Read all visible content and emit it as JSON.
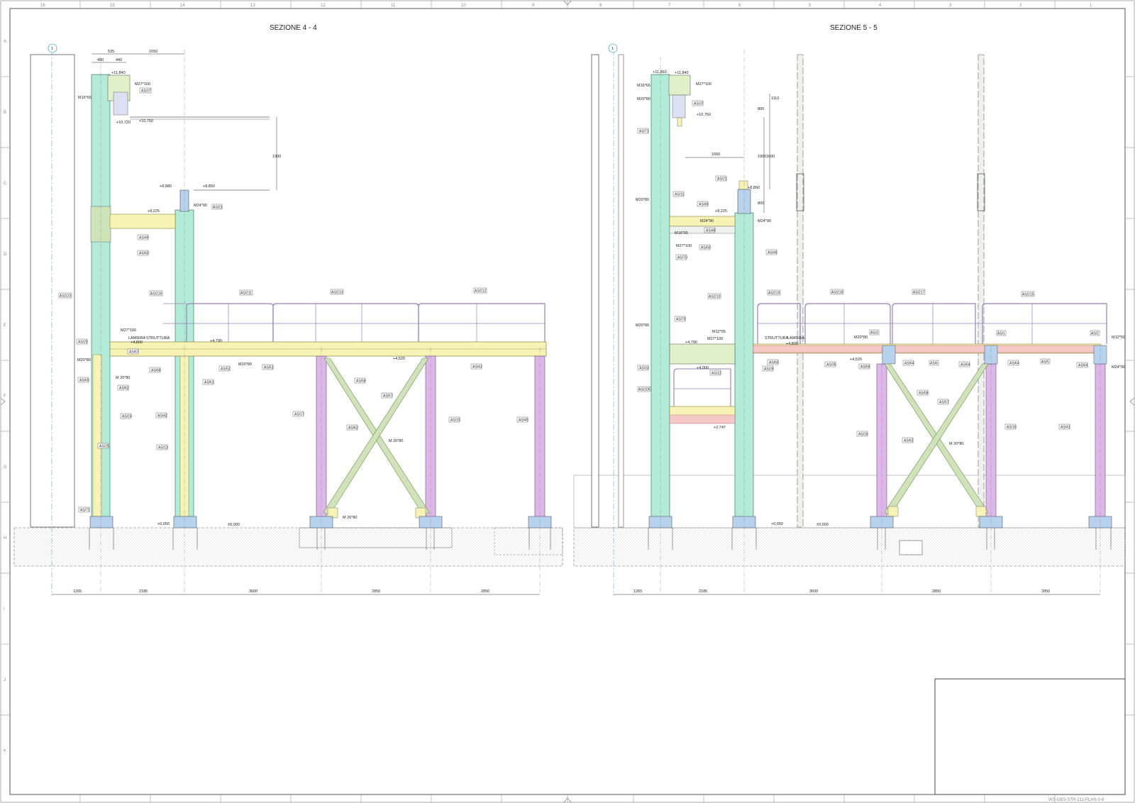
{
  "sheet": {
    "left_drawing_title": "SEZIONE 4 - 4",
    "right_drawing_title": "SEZIONE 5 - 5",
    "grid_bubble": "1",
    "border_cols": [
      "16",
      "15",
      "14",
      "13",
      "12",
      "11",
      "10",
      "9",
      "8",
      "7",
      "6",
      "5",
      "4",
      "3",
      "2",
      "1"
    ],
    "border_rows": [
      "A",
      "B",
      "C",
      "D",
      "E",
      "F",
      "G",
      "H",
      "I",
      "J",
      "K"
    ],
    "footer_code": "WS-GBS-STR-211-PLAN-0-8"
  },
  "colors": {
    "column": "#b2ecd8",
    "beam": "#f6f3b4",
    "post": "#ddb7e8",
    "brace": "#cfe3b8",
    "railing": "#9a7fb5",
    "plate_blue": "#b6d2ee",
    "pink_beam": "#f7c8c8",
    "pipe": "#eef1ee"
  },
  "left": {
    "elevations": [
      "+11,840",
      "+10,720",
      "+10,750",
      "+8,880",
      "+8,850",
      "+8,225",
      "+4,800",
      "+4,790",
      "+4,520",
      "+0,050",
      "±0,000"
    ],
    "labels": [
      "AS/37",
      "AS/21",
      "AS/49",
      "AS/60",
      "AS/223",
      "AS/216",
      "AS/211",
      "AS/213",
      "AS/212",
      "AS/20",
      "AS/67",
      "AS/68",
      "AS/65",
      "AS/62",
      "AS/24",
      "AS/42",
      "AS/61",
      "AS/52",
      "AS/51",
      "AS/43",
      "AS/58",
      "AS/57",
      "AS/17",
      "AS/62",
      "AS/15",
      "AS/45",
      "AS/25",
      "AS/13",
      "AS/72"
    ],
    "bolts": [
      "M27*100",
      "M16*65",
      "M24*90",
      "M20*80",
      "M 20*80",
      "M27*100",
      "M20*80",
      "M 20*80",
      "M 20*80"
    ],
    "notes": [
      "LAMIERA",
      "STRUTTURA"
    ],
    "top_dims": [
      "535",
      "490",
      "440",
      "1650"
    ],
    "bottom_dims": [
      "1265",
      "2185",
      "3600",
      "2850",
      "2850"
    ],
    "vertical_dim": "1900"
  },
  "right": {
    "elevations": [
      "+11,860",
      "+11,840",
      "+10,750",
      "+8,850",
      "+8,225",
      "+4,790",
      "+4,800",
      "+4,520",
      "+4,000",
      "+2,747",
      "+0,050",
      "±0,000"
    ],
    "labels": [
      "AS/37",
      "AS/71",
      "AS/21",
      "AS/11",
      "AS/49",
      "AS/48",
      "AS/50",
      "AS/70",
      "AS/46",
      "AS/70",
      "AS/210",
      "AS/219",
      "AS/218",
      "AS/217",
      "AS/215",
      "AS/3",
      "AS/1",
      "AS/2",
      "AS/33",
      "AS/12",
      "AS/26",
      "AS/60",
      "AS/35",
      "AS/66",
      "AS/64",
      "AS/6",
      "AS/64",
      "AS/5",
      "AS/64",
      "AS/64",
      "AS/205",
      "AS/58",
      "AS/57",
      "AS/16",
      "AS/62",
      "AS/16",
      "AS/41"
    ],
    "bolts": [
      "M27*100",
      "M16*65",
      "M20*80",
      "M20*80",
      "M24*90",
      "M16*65",
      "M27*100",
      "M20*80",
      "M12*55",
      "M27*100",
      "M20*80",
      "M24*90",
      "M 20*80",
      "M12*50",
      "M24*90"
    ],
    "notes": [
      "STRUTTURA",
      "LAMIERA"
    ],
    "top_dims": [
      "1650",
      "800",
      "1110",
      "1900",
      "1600",
      "800"
    ],
    "bottom_dims": [
      "1265",
      "2185",
      "3600",
      "2850",
      "2850"
    ]
  }
}
